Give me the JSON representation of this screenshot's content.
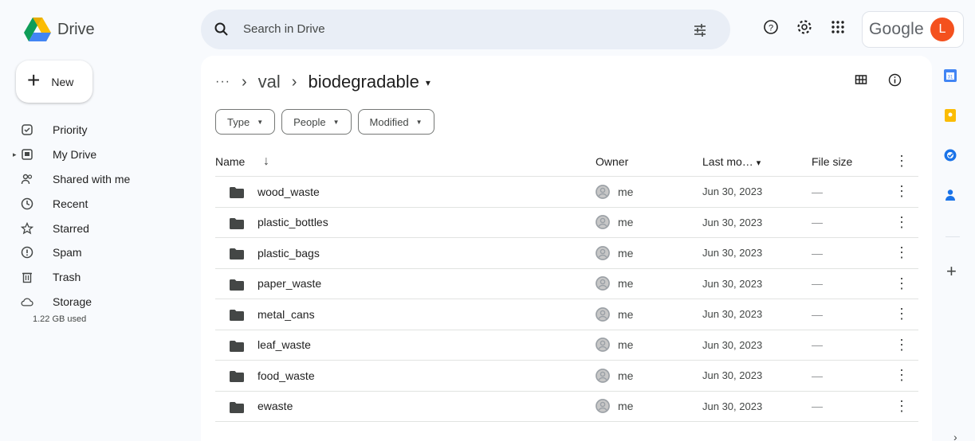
{
  "app": {
    "name": "Drive"
  },
  "search": {
    "placeholder": "Search in Drive"
  },
  "account": {
    "brand": "Google",
    "initial": "L",
    "avatar_color": "#f4511e"
  },
  "sidebar": {
    "new_label": "New",
    "items": [
      {
        "label": "Priority",
        "icon": "priority-icon"
      },
      {
        "label": "My Drive",
        "icon": "my-drive-icon"
      },
      {
        "label": "Shared with me",
        "icon": "shared-icon"
      },
      {
        "label": "Recent",
        "icon": "clock-icon"
      },
      {
        "label": "Starred",
        "icon": "star-icon"
      },
      {
        "label": "Spam",
        "icon": "spam-icon"
      },
      {
        "label": "Trash",
        "icon": "trash-icon"
      },
      {
        "label": "Storage",
        "icon": "cloud-icon"
      }
    ],
    "storage_used": "1.22 GB used"
  },
  "breadcrumb": {
    "ellipsis": "···",
    "sep": "›",
    "parent": "val",
    "current": "biodegradable",
    "caret": "▾"
  },
  "filters": [
    "Type",
    "People",
    "Modified"
  ],
  "table": {
    "headers": {
      "name": "Name",
      "owner": "Owner",
      "modified": "Last mo…",
      "modified_caret": "▾",
      "size": "File size",
      "more": "⋮"
    },
    "rows": [
      {
        "name": "wood_waste",
        "owner": "me",
        "modified": "Jun 30, 2023",
        "size": "—"
      },
      {
        "name": "plastic_bottles",
        "owner": "me",
        "modified": "Jun 30, 2023",
        "size": "—"
      },
      {
        "name": "plastic_bags",
        "owner": "me",
        "modified": "Jun 30, 2023",
        "size": "—"
      },
      {
        "name": "paper_waste",
        "owner": "me",
        "modified": "Jun 30, 2023",
        "size": "—"
      },
      {
        "name": "metal_cans",
        "owner": "me",
        "modified": "Jun 30, 2023",
        "size": "—"
      },
      {
        "name": "leaf_waste",
        "owner": "me",
        "modified": "Jun 30, 2023",
        "size": "—"
      },
      {
        "name": "food_waste",
        "owner": "me",
        "modified": "Jun 30, 2023",
        "size": "—"
      },
      {
        "name": "ewaste",
        "owner": "me",
        "modified": "Jun 30, 2023",
        "size": "—"
      }
    ]
  },
  "colors": {
    "accent": "#0b57d0",
    "surface": "#f8fafd",
    "search_bg": "#e9eef6",
    "folder": "#444746"
  }
}
